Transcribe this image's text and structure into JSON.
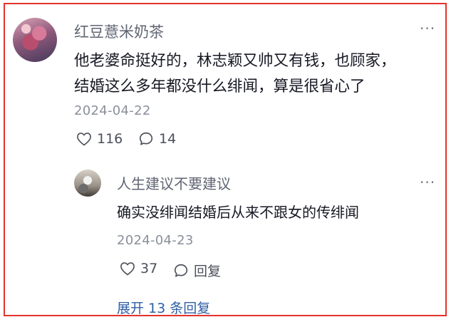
{
  "comments": [
    {
      "username": "红豆薏米奶茶",
      "lines": [
        "他老婆命挺好的，林志颖又帅又有钱，也顾家，",
        "结婚这么多年都没什么绯闻，算是很省心了"
      ],
      "date": "2024-04-22",
      "likes": "116",
      "replies": "14",
      "more": "···"
    },
    {
      "username": "人生建议不要建议",
      "lines": [
        "确实没绯闻结婚后从来不跟女的传绯闻"
      ],
      "date": "2024-04-23",
      "likes": "37",
      "reply_label": "回复",
      "more": "···"
    }
  ],
  "expand_replies": "展开 13 条回复",
  "colors": {
    "highlight_border": "#e5322d",
    "link": "#2f5fa3"
  }
}
